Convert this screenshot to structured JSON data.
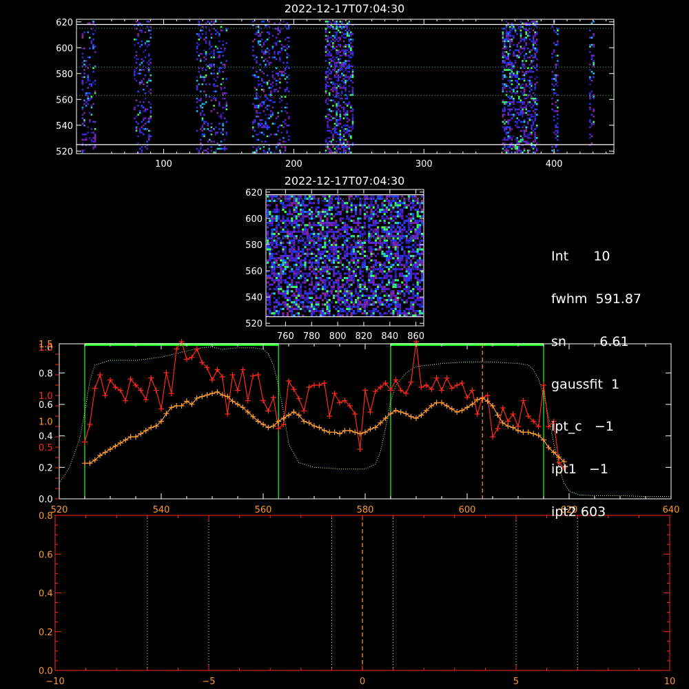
{
  "colors": {
    "axis_white": "#ffffff",
    "axis_red": "#ff2a1a",
    "axis_orange": "#ff9a2a",
    "green_line": "#22ff22",
    "dotted_profile": "#c8ffa0",
    "red_series": "#ff2a1a",
    "orange_series": "#ffa030",
    "white_hline": "#ffffff",
    "green_dotted_hline": "#22cc22"
  },
  "info_panel": [
    {
      "label": "Int",
      "value": "10",
      "text": "Int      10"
    },
    {
      "label": "fwhm",
      "value": "591.87",
      "text": "fwhm  591.87"
    },
    {
      "label": "sn",
      "value": "6.61",
      "text": "sn        6.61"
    },
    {
      "label": "gaussfit",
      "value": "1",
      "text": "gaussfit  1"
    },
    {
      "label": "ipt_c",
      "value": "-1",
      "text": "ipt_c   −1"
    },
    {
      "label": "ipt1",
      "value": "-1",
      "text": "ipt1   −1"
    },
    {
      "label": "ipt2",
      "value": "603",
      "text": "ipt2 603"
    }
  ],
  "chart_data": [
    {
      "id": "top_image",
      "type": "heatmap",
      "title": "2022-12-17T07:04:30",
      "xlim": [
        33,
        446
      ],
      "ylim": [
        518,
        622
      ],
      "xticks": [
        100,
        200,
        300,
        400
      ],
      "xtick_labels": [
        "100",
        "200",
        "300",
        "400"
      ],
      "yticks": [
        520,
        540,
        560,
        580,
        600,
        620
      ],
      "ytick_labels": [
        "520",
        "540",
        "560",
        "580",
        "600",
        "620"
      ],
      "bands_x": [
        [
          37,
          48
        ],
        [
          77,
          90
        ],
        [
          125,
          137
        ],
        [
          138,
          148
        ],
        [
          168,
          196
        ],
        [
          224,
          246
        ],
        [
          360,
          387
        ],
        [
          398,
          403
        ],
        [
          427,
          430
        ]
      ],
      "hlines_white": [
        525,
        618
      ],
      "hlines_dotted": [
        563,
        585,
        615
      ]
    },
    {
      "id": "zoom_image",
      "type": "heatmap",
      "title": "2022-12-17T07:04:30",
      "xlim": [
        745,
        866
      ],
      "ylim": [
        518,
        622
      ],
      "xticks": [
        760,
        780,
        800,
        820,
        840,
        860
      ],
      "xtick_labels": [
        "760",
        "780",
        "800",
        "820",
        "840",
        "860"
      ],
      "yticks": [
        520,
        540,
        560,
        580,
        600,
        620
      ],
      "ytick_labels": [
        "520",
        "540",
        "560",
        "580",
        "600",
        "620"
      ],
      "hlines_white": [
        525,
        618
      ],
      "hlines_dotted": [
        563,
        585,
        615
      ]
    },
    {
      "id": "profile_plot",
      "type": "line",
      "xlim": [
        520,
        640
      ],
      "xticks": [
        520,
        540,
        560,
        580,
        600,
        620,
        640
      ],
      "xtick_labels": [
        "520",
        "540",
        "560",
        "580",
        "600",
        "620",
        "640"
      ],
      "y_white": {
        "ylim": [
          0,
          0.985
        ],
        "ticks": [
          0.0,
          0.2,
          0.4,
          0.6,
          0.8
        ],
        "labels": [
          "0.0",
          "0.2",
          "0.4",
          "0.6",
          "0.8"
        ]
      },
      "y_red": {
        "ylim": [
          0,
          1.5
        ],
        "ticks": [
          0.5,
          1.0,
          1.5
        ],
        "labels": [
          "0.5",
          "1.0",
          "1.5"
        ]
      },
      "y_orange": {
        "ylim": [
          0.5,
          1.5
        ],
        "ticks": [
          1.0,
          1.5
        ],
        "labels": [
          "1.0",
          "1.5"
        ]
      },
      "top_labels": {
        "white": "1.0",
        "red": "1.5"
      },
      "green_bounds_x": [
        525,
        563,
        585,
        615
      ],
      "dashed_x": 603,
      "dotted_profile": {
        "x": [
          520,
          522,
          524,
          525,
          526,
          527,
          530,
          535,
          540,
          545,
          548,
          550,
          552,
          555,
          558,
          560,
          561,
          562,
          563,
          564,
          565,
          567,
          570,
          575,
          580,
          582,
          583,
          584,
          585,
          586,
          588,
          590,
          595,
          600,
          605,
          610,
          612,
          613,
          614,
          615,
          616,
          617,
          618,
          619,
          620,
          622,
          625,
          630,
          635,
          640
        ],
        "y": [
          0.1,
          0.2,
          0.38,
          0.55,
          0.75,
          0.85,
          0.88,
          0.88,
          0.9,
          0.94,
          0.96,
          0.965,
          0.95,
          0.96,
          0.96,
          0.95,
          0.92,
          0.85,
          0.72,
          0.55,
          0.35,
          0.23,
          0.2,
          0.19,
          0.19,
          0.22,
          0.3,
          0.45,
          0.62,
          0.72,
          0.8,
          0.84,
          0.86,
          0.87,
          0.87,
          0.86,
          0.85,
          0.82,
          0.76,
          0.66,
          0.52,
          0.35,
          0.2,
          0.1,
          0.05,
          0.025,
          0.02,
          0.02,
          0.015,
          0.015
        ]
      },
      "series": [
        {
          "axis": "red",
          "x": [
            525,
            526,
            527,
            528,
            529,
            530,
            531,
            532,
            533,
            534,
            535,
            536,
            537,
            538,
            539,
            540,
            541,
            542,
            543,
            544,
            545,
            546,
            547,
            548,
            549,
            550,
            551,
            552,
            553,
            554,
            555,
            556,
            557,
            558,
            559,
            560,
            561,
            562,
            563,
            564,
            565,
            566,
            567,
            568,
            569,
            570,
            571,
            572,
            573,
            574,
            575,
            576,
            577,
            578,
            579,
            580,
            581,
            582,
            583,
            584,
            585,
            586,
            587,
            588,
            589,
            590,
            591,
            592,
            593,
            594,
            595,
            596,
            597,
            598,
            599,
            600,
            601,
            602,
            603,
            604,
            605,
            606,
            607,
            608,
            609,
            610,
            611,
            612,
            613,
            614,
            615,
            616,
            617,
            618,
            619
          ],
          "y": [
            0.55,
            0.72,
            1.07,
            1.2,
            1.0,
            1.15,
            1.08,
            1.05,
            0.95,
            1.16,
            1.1,
            1.05,
            0.96,
            1.17,
            1.05,
            0.87,
            1.22,
            1.02,
            1.45,
            1.52,
            1.35,
            1.37,
            1.45,
            1.32,
            1.27,
            1.15,
            1.25,
            1.18,
            0.82,
            1.2,
            1.05,
            1.25,
            0.95,
            1.19,
            1.2,
            0.95,
            0.85,
            0.98,
            0.68,
            0.72,
            1.14,
            1.06,
            0.97,
            0.85,
            1.08,
            1.1,
            1.1,
            1.12,
            0.8,
            1.02,
            0.93,
            0.95,
            0.9,
            0.82,
            0.48,
            1.05,
            0.84,
            1.04,
            1.08,
            1.12,
            1.05,
            1.15,
            1.05,
            1.02,
            1.13,
            1.52,
            1.08,
            1.1,
            1.06,
            1.17,
            1.05,
            1.17,
            1.07,
            1.1,
            1.12,
            0.98,
            1.05,
            0.82,
            0.98,
            1.0,
            0.6,
            0.68,
            0.88,
            0.75,
            0.82,
            0.7,
            0.95,
            0.8,
            0.75,
            0.7,
            1.1,
            0.7,
            0.75,
            0.35,
            0.3
          ]
        },
        {
          "axis": "orange",
          "x": [
            525,
            526,
            527,
            528,
            529,
            530,
            531,
            532,
            533,
            534,
            535,
            536,
            537,
            538,
            539,
            540,
            541,
            542,
            543,
            544,
            545,
            546,
            547,
            548,
            549,
            550,
            551,
            552,
            553,
            554,
            555,
            556,
            557,
            558,
            559,
            560,
            561,
            562,
            563,
            564,
            565,
            566,
            567,
            568,
            569,
            570,
            571,
            572,
            573,
            574,
            575,
            576,
            577,
            578,
            579,
            580,
            581,
            582,
            583,
            584,
            585,
            586,
            587,
            588,
            589,
            590,
            591,
            592,
            593,
            594,
            595,
            596,
            597,
            598,
            599,
            600,
            601,
            602,
            603,
            604,
            605,
            606,
            607,
            608,
            609,
            610,
            611,
            612,
            613,
            614,
            615,
            616,
            617,
            618,
            619
          ],
          "y": [
            0.73,
            0.73,
            0.75,
            0.78,
            0.8,
            0.82,
            0.84,
            0.86,
            0.88,
            0.9,
            0.9,
            0.92,
            0.94,
            0.96,
            0.97,
            1.0,
            1.05,
            1.09,
            1.1,
            1.1,
            1.13,
            1.11,
            1.15,
            1.16,
            1.17,
            1.18,
            1.19,
            1.17,
            1.16,
            1.13,
            1.11,
            1.09,
            1.06,
            1.03,
            1.0,
            0.98,
            0.96,
            0.97,
            1.0,
            1.02,
            1.04,
            1.06,
            1.04,
            1.0,
            0.99,
            0.97,
            0.96,
            0.94,
            0.93,
            0.93,
            0.92,
            0.94,
            0.94,
            0.93,
            0.92,
            0.93,
            0.95,
            0.96,
            0.99,
            1.02,
            1.05,
            1.07,
            1.06,
            1.05,
            1.03,
            1.02,
            1.04,
            1.07,
            1.1,
            1.12,
            1.12,
            1.1,
            1.08,
            1.06,
            1.07,
            1.09,
            1.11,
            1.14,
            1.15,
            1.13,
            1.1,
            1.04,
            0.99,
            0.97,
            0.96,
            0.94,
            0.93,
            0.93,
            0.92,
            0.91,
            0.88,
            0.83,
            0.8,
            0.77,
            0.74
          ]
        }
      ]
    },
    {
      "id": "bottom_plot",
      "type": "line",
      "xlim": [
        -10,
        10
      ],
      "ylim": [
        0,
        0.8
      ],
      "xticks": [
        -10,
        -5,
        0,
        5,
        10
      ],
      "xtick_labels": [
        "−10",
        "−5",
        "0",
        "5",
        "10"
      ],
      "yticks": [
        0.0,
        0.2,
        0.4,
        0.6,
        0.8
      ],
      "ytick_labels": [
        "0.0",
        "0.2",
        "0.4",
        "0.6",
        "0.8"
      ],
      "dotted_vlines_x": [
        -7,
        -5,
        -1,
        1,
        5,
        7
      ],
      "dashed_vline_x": 0
    }
  ]
}
